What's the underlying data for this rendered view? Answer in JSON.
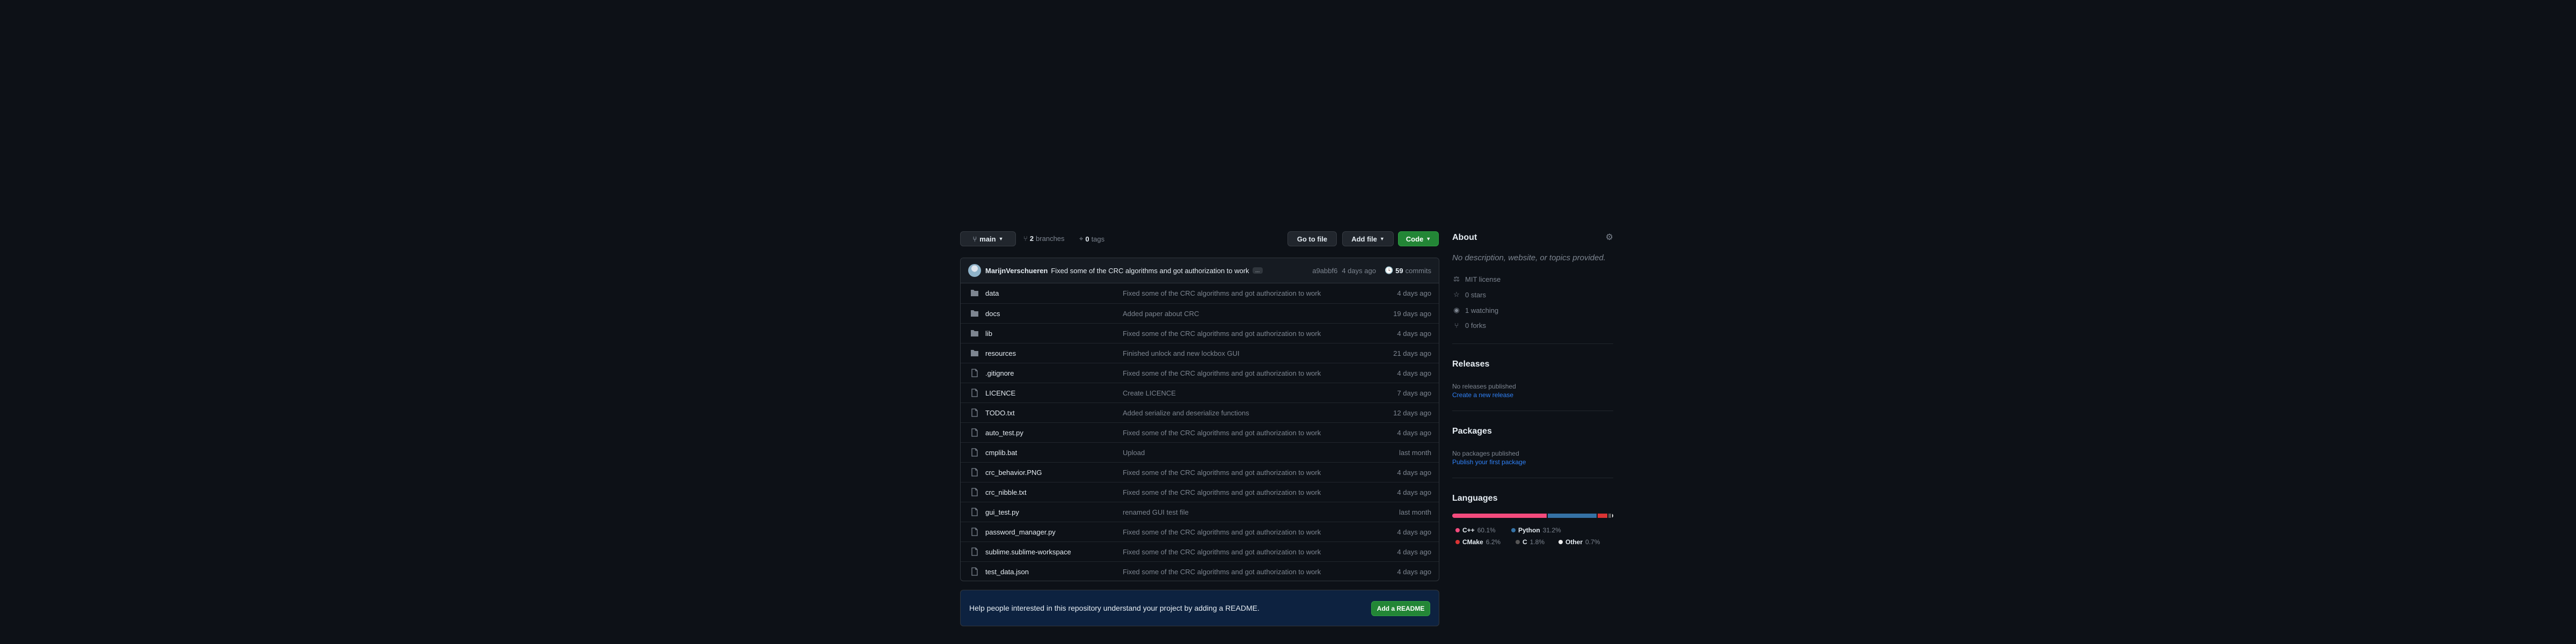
{
  "toolbar": {
    "branch": "main",
    "branches_count": "2",
    "branches_label": "branches",
    "tags_count": "0",
    "tags_label": "tags",
    "go_to_file": "Go to file",
    "add_file": "Add file",
    "code": "Code"
  },
  "commit": {
    "author": "MarijnVerschueren",
    "message": "Fixed some of the CRC algorithms and got authorization to work",
    "ellipsis": "…",
    "hash": "a9abbf6",
    "time": "4 days ago",
    "count": "59",
    "count_label": "commits"
  },
  "files": [
    {
      "type": "folder",
      "name": "data",
      "message": "Fixed some of the CRC algorithms and got authorization to work",
      "date": "4 days ago"
    },
    {
      "type": "folder",
      "name": "docs",
      "message": "Added paper about CRC",
      "date": "19 days ago"
    },
    {
      "type": "folder",
      "name": "lib",
      "message": "Fixed some of the CRC algorithms and got authorization to work",
      "date": "4 days ago"
    },
    {
      "type": "folder",
      "name": "resources",
      "message": "Finished unlock and new lockbox GUI",
      "date": "21 days ago"
    },
    {
      "type": "file",
      "name": ".gitignore",
      "message": "Fixed some of the CRC algorithms and got authorization to work",
      "date": "4 days ago"
    },
    {
      "type": "file",
      "name": "LICENCE",
      "message": "Create LICENCE",
      "date": "7 days ago"
    },
    {
      "type": "file",
      "name": "TODO.txt",
      "message": "Added serialize and deserialize functions",
      "date": "12 days ago"
    },
    {
      "type": "file",
      "name": "auto_test.py",
      "message": "Fixed some of the CRC algorithms and got authorization to work",
      "date": "4 days ago"
    },
    {
      "type": "file",
      "name": "cmplib.bat",
      "message": "Upload",
      "date": "last month"
    },
    {
      "type": "file",
      "name": "crc_behavior.PNG",
      "message": "Fixed some of the CRC algorithms and got authorization to work",
      "date": "4 days ago"
    },
    {
      "type": "file",
      "name": "crc_nibble.txt",
      "message": "Fixed some of the CRC algorithms and got authorization to work",
      "date": "4 days ago"
    },
    {
      "type": "file",
      "name": "gui_test.py",
      "message": "renamed GUI test file",
      "date": "last month"
    },
    {
      "type": "file",
      "name": "password_manager.py",
      "message": "Fixed some of the CRC algorithms and got authorization to work",
      "date": "4 days ago"
    },
    {
      "type": "file",
      "name": "sublime.sublime-workspace",
      "message": "Fixed some of the CRC algorithms and got authorization to work",
      "date": "4 days ago"
    },
    {
      "type": "file",
      "name": "test_data.json",
      "message": "Fixed some of the CRC algorithms and got authorization to work",
      "date": "4 days ago"
    }
  ],
  "readme": {
    "text": "Help people interested in this repository understand your project by adding a README.",
    "button": "Add a README"
  },
  "about": {
    "title": "About",
    "description": "No description, website, or topics provided.",
    "license": "MIT license",
    "stars": "0 stars",
    "watching": "1 watching",
    "forks": "0 forks"
  },
  "releases": {
    "title": "Releases",
    "none": "No releases published",
    "link": "Create a new release"
  },
  "packages": {
    "title": "Packages",
    "none": "No packages published",
    "link": "Publish your first package"
  },
  "languages": {
    "title": "Languages",
    "items": [
      {
        "name": "C++",
        "percent": "60.1%",
        "value": 60.1,
        "color": "#f34b7d"
      },
      {
        "name": "Python",
        "percent": "31.2%",
        "value": 31.2,
        "color": "#3572A5"
      },
      {
        "name": "CMake",
        "percent": "6.2%",
        "value": 6.2,
        "color": "#DA3434"
      },
      {
        "name": "C",
        "percent": "1.8%",
        "value": 1.8,
        "color": "#555555"
      },
      {
        "name": "Other",
        "percent": "0.7%",
        "value": 0.7,
        "color": "#ededed"
      }
    ]
  }
}
